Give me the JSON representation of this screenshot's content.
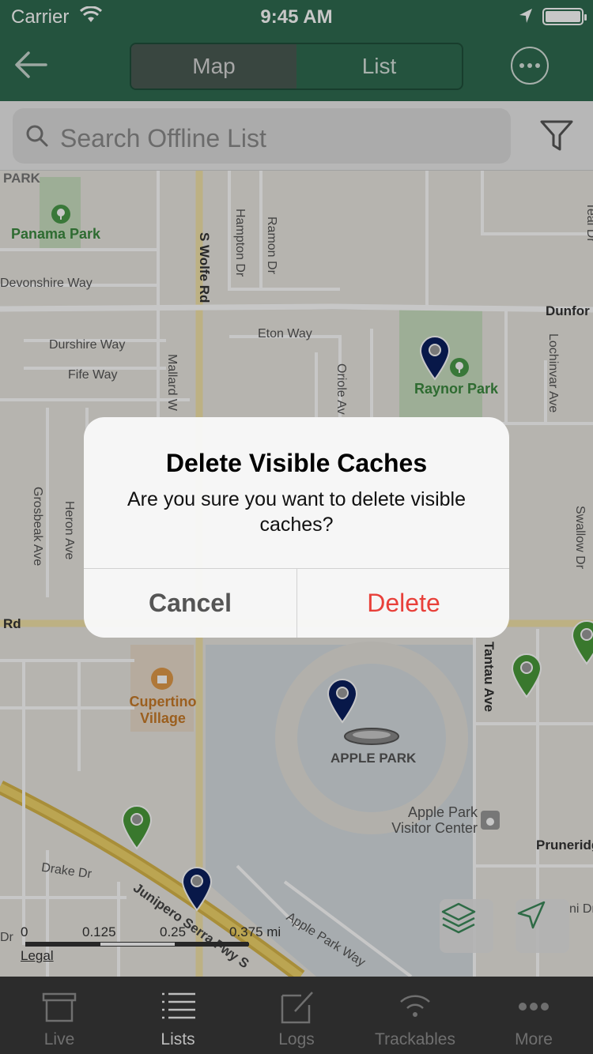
{
  "status": {
    "carrier": "Carrier",
    "time": "9:45 AM"
  },
  "nav": {
    "tabs": [
      {
        "label": "Map",
        "active": true
      },
      {
        "label": "List",
        "active": false
      }
    ]
  },
  "search": {
    "placeholder": "Search Offline List"
  },
  "map": {
    "labels": {
      "panama_park": "Panama Park",
      "park_top": "PARK",
      "devonshire": "Devonshire Way",
      "durshire": "Durshire Way",
      "fife": "Fife Way",
      "eton": "Eton Way",
      "wolfe": "S Wolfe Rd",
      "hampton": "Hampton Dr",
      "ramon": "Ramon Dr",
      "mallard": "Mallard W",
      "oriole": "Oriole Av",
      "raynor_park": "Raynor Park",
      "dunford": "Dunfor",
      "lochinvar": "Lochinvar Ave",
      "teal": "Teal Dr",
      "grosbeak": "Grosbeak Ave",
      "heron": "Heron Ave",
      "swallow": "Swallow Dr",
      "rd": "Rd",
      "tantau": "Tantau Ave",
      "cupertino_village": "Cupertino Village",
      "apple_park": "APPLE PARK",
      "apple_visitor": "Apple Park Visitor Center",
      "pruneridge": "Pruneridge",
      "drake": "Drake Dr",
      "junipero": "Junipero Serra Fwy S",
      "apple_park_way": "Apple Park Way",
      "dr_left": "Dr",
      "ni_dr": "ni Dr"
    },
    "scale": {
      "ticks": [
        "0",
        "0.125",
        "0.25",
        "0.375 mi"
      ],
      "legal": "Legal"
    }
  },
  "alert": {
    "title": "Delete Visible Caches",
    "message": "Are you sure you want to delete visible caches?",
    "cancel": "Cancel",
    "delete": "Delete"
  },
  "tabbar": {
    "items": [
      {
        "label": "Live",
        "icon": "box-icon",
        "active": false
      },
      {
        "label": "Lists",
        "icon": "list-icon",
        "active": true
      },
      {
        "label": "Logs",
        "icon": "edit-icon",
        "active": false
      },
      {
        "label": "Trackables",
        "icon": "signal-icon",
        "active": false
      },
      {
        "label": "More",
        "icon": "more-icon",
        "active": false
      }
    ]
  },
  "colors": {
    "header": "#2f6b50",
    "delete": "#e8403a",
    "pin_blue": "#0b1f5e",
    "pin_green": "#4a9a3a"
  }
}
